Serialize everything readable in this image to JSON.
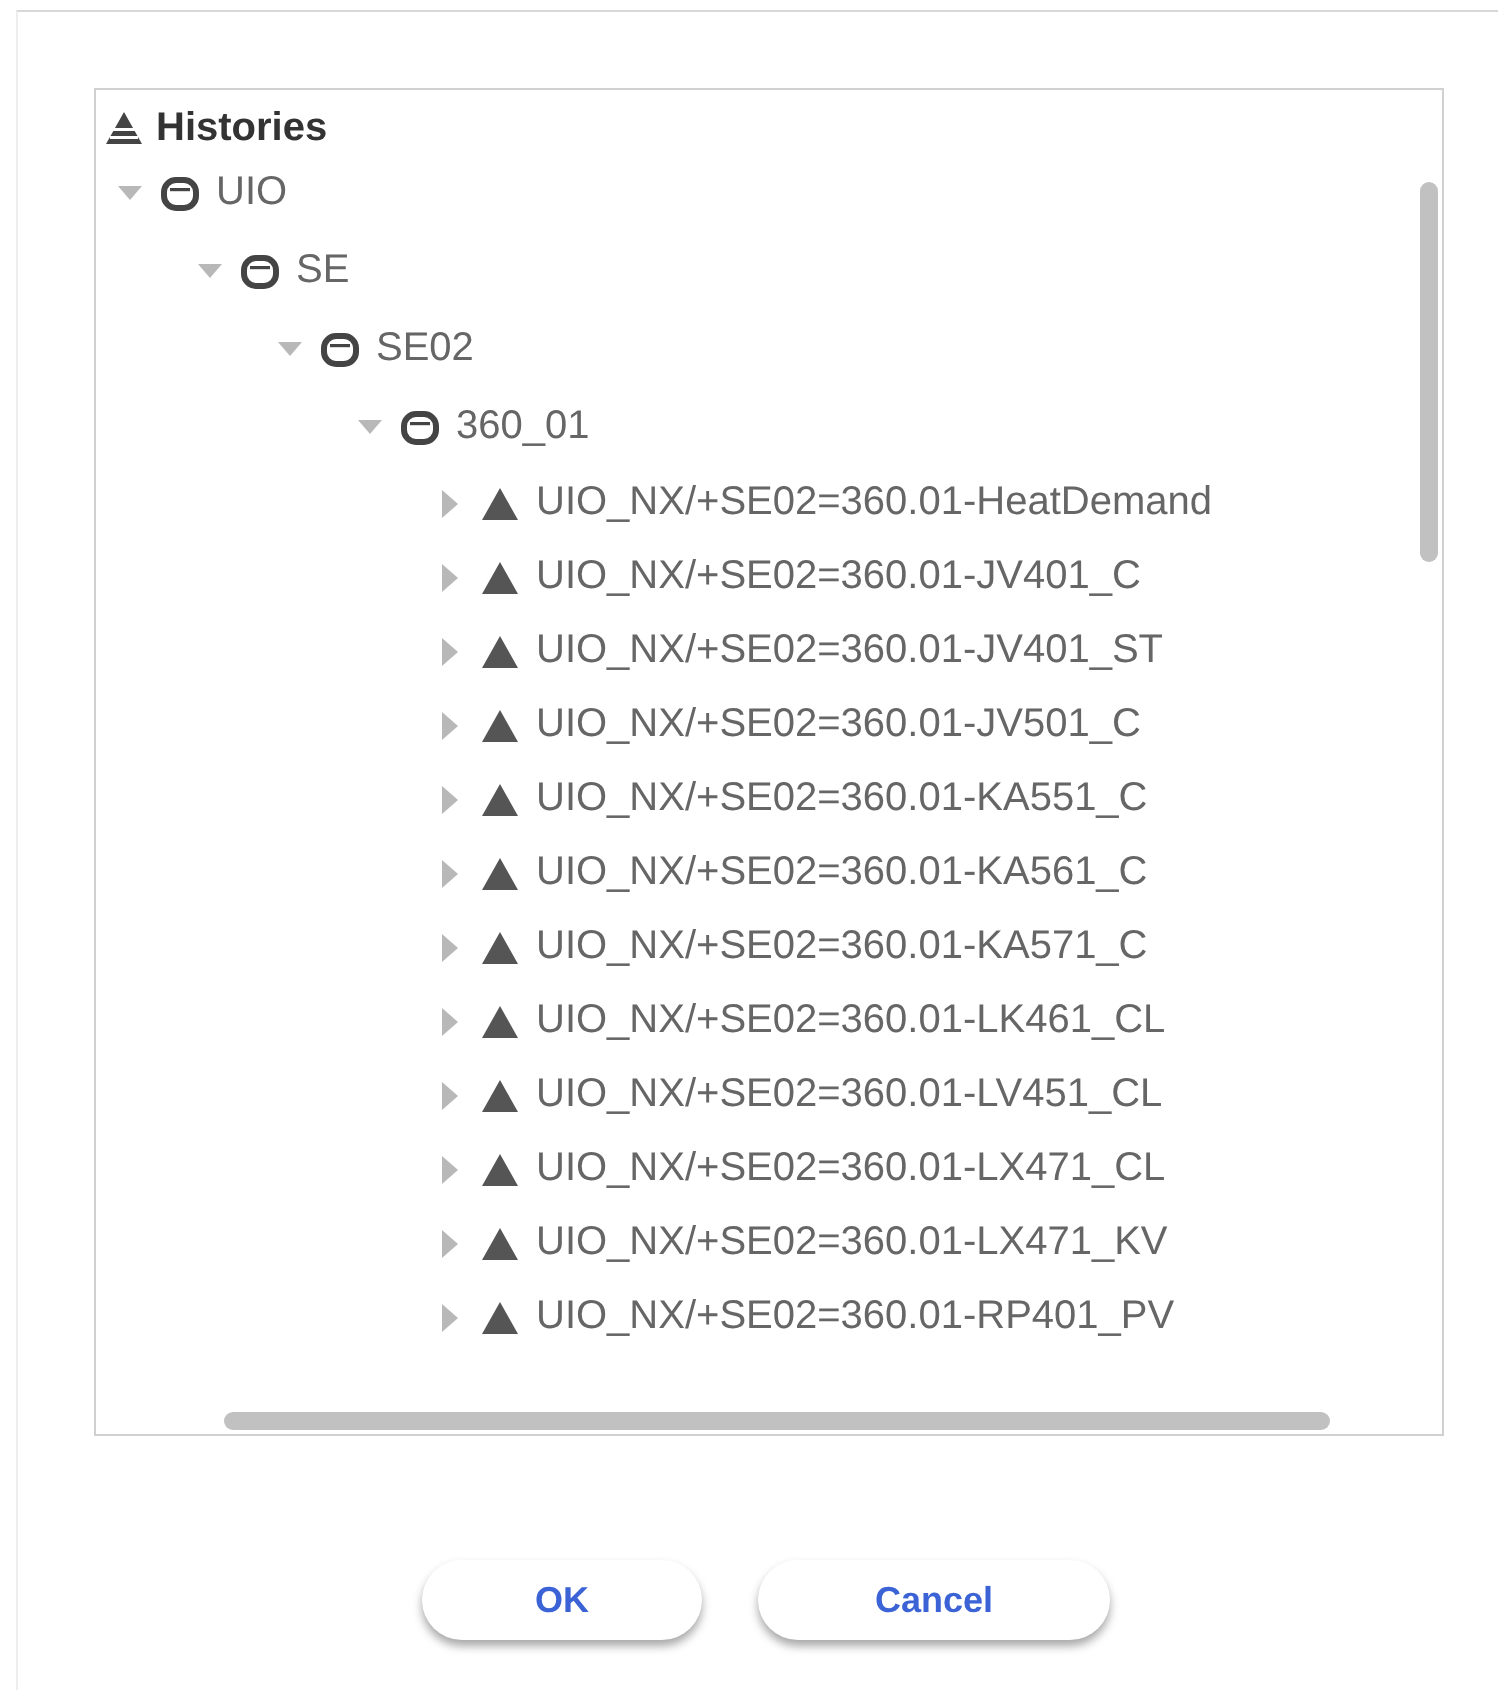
{
  "tree": {
    "label": "Histories",
    "children": [
      {
        "label": "UIO",
        "kind": "folder",
        "expanded": true,
        "children": [
          {
            "label": "SE",
            "kind": "folder",
            "expanded": true,
            "children": [
              {
                "label": "SE02",
                "kind": "folder",
                "expanded": true,
                "children": [
                  {
                    "label": "360_01",
                    "kind": "folder",
                    "expanded": true,
                    "children": [
                      {
                        "label": "UIO_NX/+SE02=360.01-HeatDemand",
                        "kind": "point",
                        "expanded": false
                      },
                      {
                        "label": "UIO_NX/+SE02=360.01-JV401_C",
                        "kind": "point",
                        "expanded": false
                      },
                      {
                        "label": "UIO_NX/+SE02=360.01-JV401_ST",
                        "kind": "point",
                        "expanded": false
                      },
                      {
                        "label": "UIO_NX/+SE02=360.01-JV501_C",
                        "kind": "point",
                        "expanded": false
                      },
                      {
                        "label": "UIO_NX/+SE02=360.01-KA551_C",
                        "kind": "point",
                        "expanded": false
                      },
                      {
                        "label": "UIO_NX/+SE02=360.01-KA561_C",
                        "kind": "point",
                        "expanded": false
                      },
                      {
                        "label": "UIO_NX/+SE02=360.01-KA571_C",
                        "kind": "point",
                        "expanded": false
                      },
                      {
                        "label": "UIO_NX/+SE02=360.01-LK461_CL",
                        "kind": "point",
                        "expanded": false
                      },
                      {
                        "label": "UIO_NX/+SE02=360.01-LV451_CL",
                        "kind": "point",
                        "expanded": false
                      },
                      {
                        "label": "UIO_NX/+SE02=360.01-LX471_CL",
                        "kind": "point",
                        "expanded": false
                      },
                      {
                        "label": "UIO_NX/+SE02=360.01-LX471_KV",
                        "kind": "point",
                        "expanded": false
                      },
                      {
                        "label": "UIO_NX/+SE02=360.01-RP401_PV",
                        "kind": "point",
                        "expanded": false
                      }
                    ]
                  }
                ]
              }
            ]
          }
        ]
      }
    ]
  },
  "buttons": [
    "OK",
    "Cancel"
  ]
}
